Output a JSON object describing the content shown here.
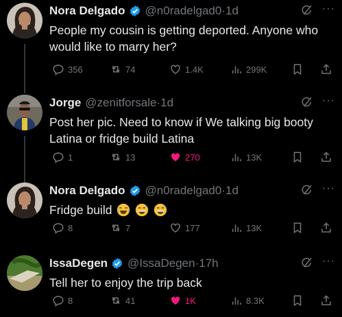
{
  "tweets": [
    {
      "name": "Nora Delgado",
      "verified": true,
      "handle": "@n0radelgad0",
      "time": "1d",
      "text": "People my cousin is getting deported. Anyone who would like to marry her?",
      "replies": "356",
      "reposts": "74",
      "likes": "1.4K",
      "liked": false,
      "views": "299K"
    },
    {
      "name": "Jorge",
      "verified": false,
      "handle": "@zenitforsale",
      "time": "1d",
      "text": "Post her pic. Need to know if We talking big booty Latina or fridge build Latina",
      "replies": "1",
      "reposts": "13",
      "likes": "270",
      "liked": true,
      "views": "13K"
    },
    {
      "name": "Nora Delgado",
      "verified": true,
      "handle": "@n0radelgad0",
      "time": "1d",
      "text": "Fridge build",
      "emojis": [
        "crying-laughing-emoji",
        "grinning-sweat-emoji",
        "grinning-sweat-emoji"
      ],
      "replies": "8",
      "reposts": "7",
      "likes": "177",
      "liked": false,
      "views": "13K"
    },
    {
      "name": "IssaDegen",
      "verified": true,
      "handle": "@IssaDegen",
      "time": "17h",
      "text": "Tell her to enjoy the trip back",
      "replies": "8",
      "reposts": "41",
      "likes": "1K",
      "liked": true,
      "views": "8.3K"
    }
  ],
  "separator": "·",
  "more_glyph": "···",
  "colors": {
    "background": "#000000",
    "text": "#e7e9ea",
    "muted": "#71767b",
    "verified": "#1d9bf0",
    "like_active": "#f91880",
    "thread_line": "#333639"
  }
}
